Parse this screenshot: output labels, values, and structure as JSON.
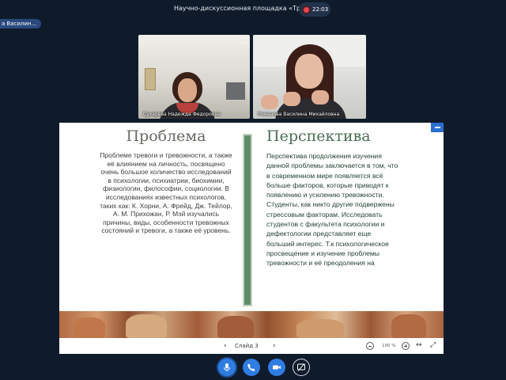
{
  "header": {
    "room_title": "Научно-дискуссионная площадка «Трибуна»",
    "timer": "22:03",
    "recording_color": "#e8474d"
  },
  "active_speaker": {
    "label": "а Василин..."
  },
  "participants": [
    {
      "name": "Сухарева Надежда Федоровна",
      "expand_icon": "expand-icon"
    },
    {
      "name": "Романова Василина Михайловна",
      "expand_icon": "expand-icon"
    }
  ],
  "slide": {
    "left_heading": "Проблема",
    "left_text": "Проблеме тревоги и тревожности, а также её влиянием на личность, посвящено очень большое количество исследований в психологии, психиатрии, биохимии, физиологии, философии, социологии. В исследованиях известных психологов, таких как: К. Хорни, А. Фрейд, Дж. Тейлор, А. М. Прихожан, Р. Мэй изучались причины, виды, особенности тревожных состояний и тревоги, а также её уровень.",
    "right_heading": "Перспектива",
    "right_text": "Перспектива продолжения изучения данной проблемы заключается в том, что в современном мире появляется всё больше факторов, которые приводят к появлению и усилению тревожности.  Студенты, как никто другие подвержены стрессовым факторам.  Исследовать студентов с факультета психологии и дефектологии представляет еще больший интерес. Т.к психологическое просвещение и изучение проблемы тревожности и её преодоления на",
    "divider_color": "#5e8c67",
    "left_heading_color": "#6a6a64",
    "right_heading_color": "#4a6e57"
  },
  "presentation_controls": {
    "prev_icon": "chevron-left-icon",
    "prev_glyph": "‹",
    "slide_label": "Слайд 3",
    "next_icon": "chevron-right-icon",
    "next_glyph": "›",
    "zoom_level": "100 %",
    "fit_glyph": "↔",
    "fullscreen_glyph": "⤢"
  },
  "bottom_controls": [
    {
      "icon": "microphone-icon",
      "state": "on"
    },
    {
      "icon": "phone-icon",
      "state": "on"
    },
    {
      "icon": "camera-icon",
      "state": "on"
    },
    {
      "icon": "screen-share-icon",
      "state": "off"
    }
  ],
  "colors": {
    "background": "#0f1b2b",
    "accent": "#2f7de3",
    "speaker_pill": "#2a4a7e"
  }
}
